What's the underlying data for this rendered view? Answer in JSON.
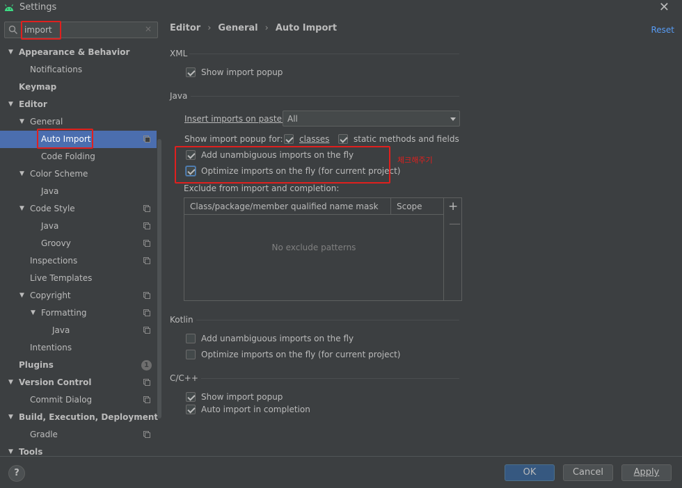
{
  "window": {
    "title": "Settings",
    "close_label": "✕"
  },
  "search": {
    "value": "import",
    "clear": "✕"
  },
  "tree": [
    {
      "label": "Appearance & Behavior",
      "bold": true,
      "arrow": true,
      "indent": 0
    },
    {
      "label": "Notifications",
      "indent": 1
    },
    {
      "label": "Keymap",
      "bold": true,
      "indent": 0
    },
    {
      "label": "Editor",
      "bold": true,
      "arrow": true,
      "indent": 0
    },
    {
      "label": "General",
      "arrow": true,
      "indent": 1
    },
    {
      "label": "Auto Import",
      "indent": 2,
      "selected": true,
      "copy": true
    },
    {
      "label": "Code Folding",
      "indent": 2
    },
    {
      "label": "Color Scheme",
      "arrow": true,
      "indent": 1
    },
    {
      "label": "Java",
      "indent": 2
    },
    {
      "label": "Code Style",
      "arrow": true,
      "indent": 1,
      "copy": true
    },
    {
      "label": "Java",
      "indent": 2,
      "copy": true
    },
    {
      "label": "Groovy",
      "indent": 2,
      "copy": true
    },
    {
      "label": "Inspections",
      "indent": 1,
      "copy": true
    },
    {
      "label": "Live Templates",
      "indent": 1
    },
    {
      "label": "Copyright",
      "arrow": true,
      "indent": 1,
      "copy": true
    },
    {
      "label": "Formatting",
      "arrow": true,
      "indent": 2,
      "copy": true
    },
    {
      "label": "Java",
      "indent": 3,
      "copy": true
    },
    {
      "label": "Intentions",
      "indent": 1
    },
    {
      "label": "Plugins",
      "bold": true,
      "indent": 0,
      "badge": "1"
    },
    {
      "label": "Version Control",
      "bold": true,
      "arrow": true,
      "indent": 0,
      "copy": true
    },
    {
      "label": "Commit Dialog",
      "indent": 1,
      "copy": true
    },
    {
      "label": "Build, Execution, Deployment",
      "bold": true,
      "arrow": true,
      "indent": 0
    },
    {
      "label": "Gradle",
      "indent": 1,
      "copy": true
    },
    {
      "label": "Tools",
      "bold": true,
      "arrow": true,
      "indent": 0
    }
  ],
  "breadcrumb": [
    "Editor",
    "General",
    "Auto Import"
  ],
  "reset_label": "Reset",
  "xml": {
    "title": "XML",
    "show_popup": {
      "label": "Show import popup",
      "checked": true
    }
  },
  "java": {
    "title": "Java",
    "insert_label": "Insert imports on paste:",
    "insert_value": "All",
    "show_popup_label": "Show import popup for:",
    "classes": {
      "label": "classes",
      "checked": true
    },
    "static": {
      "label": "static methods and fields",
      "checked": true
    },
    "add_unambiguous": {
      "label": "Add unambiguous imports on the fly",
      "checked": true
    },
    "optimize": {
      "label": "Optimize imports on the fly (for current project)",
      "checked": true
    },
    "annotation": "체크해주기",
    "exclude_label": "Exclude from import and completion:",
    "table_headers": [
      "Class/package/member qualified name mask",
      "Scope"
    ],
    "empty_text": "No exclude patterns",
    "add_tool": "+",
    "remove_tool": "—"
  },
  "kotlin": {
    "title": "Kotlin",
    "add_unambiguous": {
      "label": "Add unambiguous imports on the fly",
      "checked": false
    },
    "optimize": {
      "label": "Optimize imports on the fly (for current project)",
      "checked": false
    }
  },
  "cpp": {
    "title": "C/C++",
    "show_popup": {
      "label": "Show import popup",
      "checked": true
    },
    "auto_import": {
      "label": "Auto import in completion",
      "checked": true
    }
  },
  "footer": {
    "help": "?",
    "ok": "OK",
    "cancel": "Cancel",
    "apply": "Apply"
  },
  "colors": {
    "background": "#3c3f41",
    "selection": "#4b6eaf",
    "link": "#589df6",
    "highlight": "#e0201e",
    "primary_button": "#365880"
  }
}
